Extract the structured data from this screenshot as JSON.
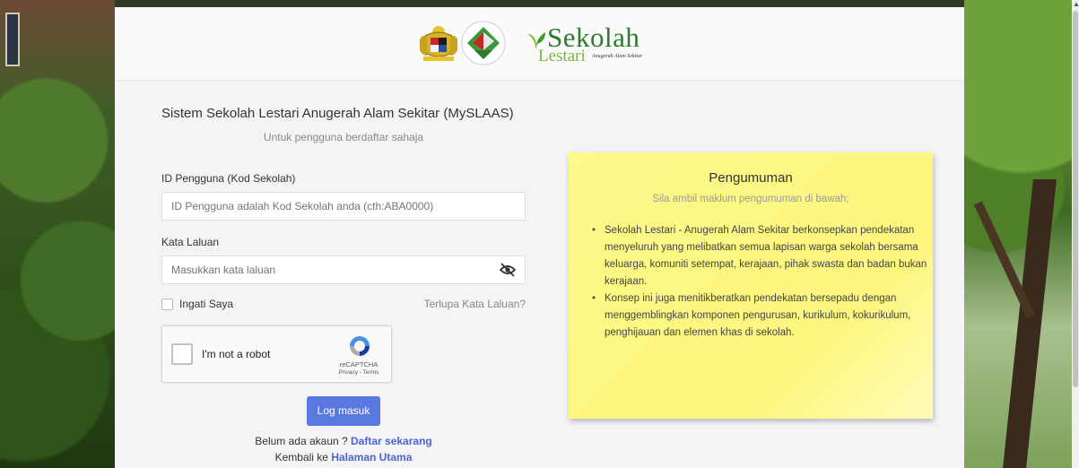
{
  "header": {
    "logo_word_1": "Sekolah",
    "logo_word_2": "Lestari",
    "logo_tagline": "Anugerah Alam Sekitar"
  },
  "login": {
    "title": "Sistem Sekolah Lestari Anugerah Alam Sekitar (MySLAAS)",
    "subtitle": "Untuk pengguna berdaftar sahaja",
    "user_label": "ID Pengguna (Kod Sekolah)",
    "user_placeholder": "ID Pengguna adalah Kod Sekolah anda (cth:ABA0000)",
    "password_label": "Kata Laluan",
    "password_placeholder": "Masukkan kata laluan",
    "remember_label": "Ingati Saya",
    "forgot_label": "Terlupa Kata Laluan?",
    "submit_label": "Log masuk",
    "signup_prompt": "Belum ada akaun ?",
    "signup_link": "Daftar sekarang",
    "home_prompt": "Kembali ke",
    "home_link": "Halaman Utama"
  },
  "recaptcha": {
    "label": "I'm not a robot",
    "brand": "reCAPTCHA",
    "terms": "Privacy - Terms"
  },
  "announcement": {
    "title": "Pengumuman",
    "subtitle": "Sila ambil maklum pengumuman di bawah;",
    "items": [
      "Sekolah Lestari - Anugerah Alam Sekitar berkonsepkan pendekatan menyeluruh yang melibatkan semua lapisan warga sekolah bersama keluarga, komuniti setempat, kerajaan, pihak swasta dan badan bukan kerajaan.",
      "Konsep ini juga menitikberatkan pendekatan bersepadu dengan menggemblingkan komponen pengurusan, kurikulum, kokurikulum, penghijauan dan elemen khas di sekolah."
    ]
  },
  "colors": {
    "primary_button": "#5a79e0",
    "link": "#4a67c9",
    "notice_bg": "#fdf98a"
  }
}
